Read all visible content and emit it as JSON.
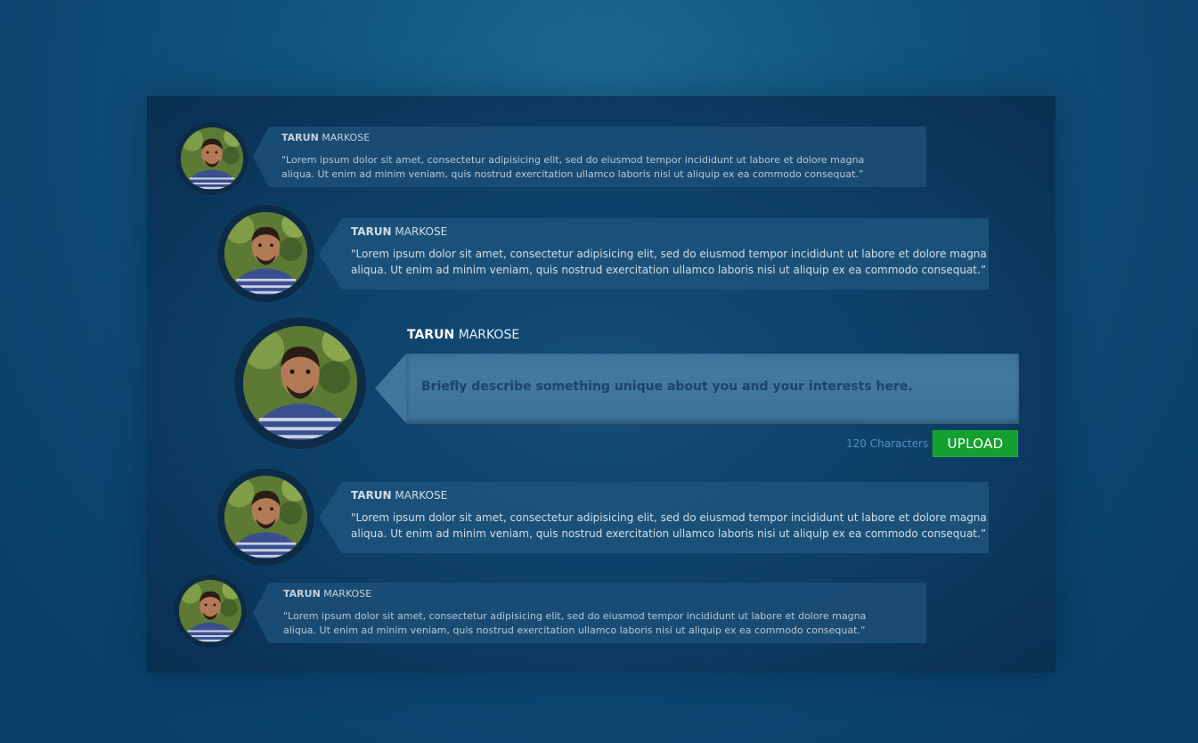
{
  "comments": [
    {
      "first_name": "TARUN",
      "last_name": "MARKOSE",
      "line1": "\"Lorem ipsum dolor sit amet, consectetur adipisicing elit, sed do eiusmod tempor incididunt ut labore et dolore magna",
      "line2": "aliqua. Ut enim ad minim veniam, quis nostrud exercitation ullamco laboris nisi ut aliquip ex ea commodo consequat.”"
    },
    {
      "first_name": "TARUN",
      "last_name": "MARKOSE",
      "line1": "\"Lorem ipsum dolor sit amet, consectetur adipisicing elit, sed do eiusmod tempor incididunt ut labore et dolore magna",
      "line2": "aliqua. Ut enim ad minim veniam, quis nostrud exercitation ullamco laboris nisi ut aliquip ex ea commodo consequat.”"
    },
    {
      "first_name": "TARUN",
      "last_name": "MARKOSE",
      "line1": "\"Lorem ipsum dolor sit amet, consectetur adipisicing elit, sed do eiusmod tempor incididunt ut labore et dolore magna",
      "line2": "aliqua. Ut enim ad minim veniam, quis nostrud exercitation ullamco laboris nisi ut aliquip ex ea commodo consequat.”"
    },
    {
      "first_name": "TARUN",
      "last_name": "MARKOSE",
      "line1": "\"Lorem ipsum dolor sit amet, consectetur adipisicing elit, sed do eiusmod tempor incididunt ut labore et dolore magna",
      "line2": "aliqua. Ut enim ad minim veniam, quis nostrud exercitation ullamco laboris nisi ut aliquip ex ea commodo consequat.”"
    }
  ],
  "composer": {
    "first_name": "TARUN",
    "last_name": "MARKOSE",
    "placeholder": "Briefly describe something unique about you and your interests here.",
    "char_count": "120 Characters",
    "upload_label": "UPLOAD"
  },
  "colors": {
    "upload_button": "#14a02e",
    "char_count": "#4f93c4"
  }
}
